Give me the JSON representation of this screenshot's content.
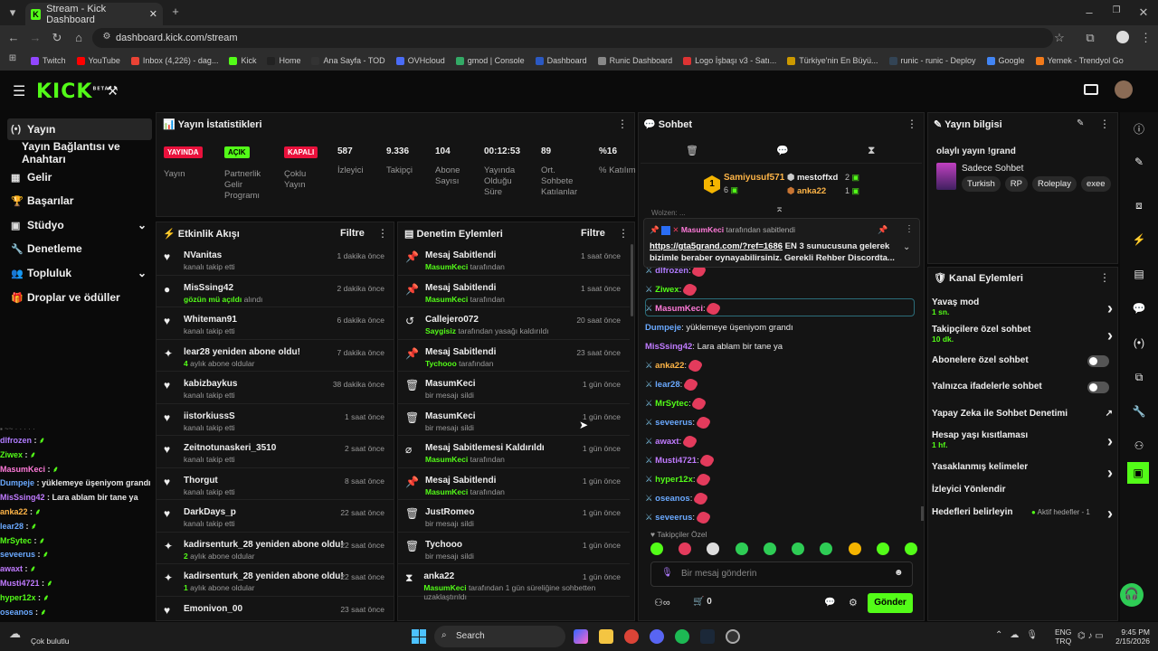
{
  "browser": {
    "tab_title": "Stream - Kick Dashboard",
    "url": "dashboard.kick.com/stream",
    "bookmarks": [
      "Twitch",
      "YouTube",
      "Inbox (4,226) - dag...",
      "Kick",
      "Home",
      "Ana Sayfa - TOD",
      "OVHcloud",
      "gmod | Console",
      "Dashboard",
      "Runic Dashboard",
      "Logo İşbaşı v3 - Satı...",
      "Türkiye'nin En Büyü...",
      "runic - runic - Deploy",
      "Google",
      "Yemek - Trendyol Go"
    ],
    "bookmark_colors": [
      "#9146ff",
      "#ff0000",
      "#ea4335",
      "#53fc18",
      "#222",
      "#333",
      "#4a6cf7",
      "#3a6",
      "#2b59c3",
      "#888",
      "#d33",
      "#c90",
      "#345",
      "#4285f4",
      "#f27a1a"
    ]
  },
  "kick": {
    "logo": "KICK",
    "beta": "BETA"
  },
  "sidebar": {
    "items": [
      {
        "label": "Yayın",
        "icon": "(•)"
      },
      {
        "label": "Yayın Bağlantısı ve Anahtarı",
        "icon": ""
      },
      {
        "label": "Gelir",
        "icon": "▦"
      },
      {
        "label": "Başarılar",
        "icon": "🏆"
      },
      {
        "label": "Stüdyo",
        "icon": "▣",
        "chevron": "⌄"
      },
      {
        "label": "Denetleme",
        "icon": "🔧"
      },
      {
        "label": "Topluluk",
        "icon": "👥",
        "chevron": "⌄"
      },
      {
        "label": "Droplar ve ödüller",
        "icon": "🎁"
      }
    ]
  },
  "stats": {
    "title": "Yayın İstatistikleri",
    "tags": [
      {
        "tag": "YAYINDA",
        "label": "Yayın",
        "color": "#e9113c"
      },
      {
        "tag": "AÇIK",
        "label": "Partnerlik Gelir Programı",
        "color": "#53fc18"
      },
      {
        "tag": "KAPALI",
        "label": "Çoklu Yayın",
        "color": "#e9113c"
      }
    ],
    "numbers": [
      {
        "value": "587",
        "label": "İzleyici"
      },
      {
        "value": "9.336",
        "label": "Takipçi"
      },
      {
        "value": "104",
        "label": "Abone Sayısı"
      },
      {
        "value": "00:12:53",
        "label": "Yayında Olduğu Süre"
      },
      {
        "value": "89",
        "label": "Ort. Sohbete Katılanlar"
      },
      {
        "value": "%16",
        "label": "% Katılım"
      }
    ]
  },
  "activity": {
    "title": "Etkinlik Akışı",
    "filter": "Filtre",
    "rows": [
      {
        "icon": "♥",
        "name": "NVanitas",
        "sub": "kanalı takip etti",
        "subhl": "",
        "time": "1 dakika önce"
      },
      {
        "icon": "●",
        "name": "MisSsing42",
        "sub": "alındı",
        "subhl": "gözün mü açıldı",
        "time": "2 dakika önce"
      },
      {
        "icon": "♥",
        "name": "Whiteman91",
        "sub": "kanalı takip etti",
        "subhl": "",
        "time": "6 dakika önce"
      },
      {
        "icon": "✦",
        "name": "lear28 yeniden abone oldu!",
        "sub": "aylık abone oldular",
        "subhl": "4",
        "time": "7 dakika önce"
      },
      {
        "icon": "♥",
        "name": "kabizbaykus",
        "sub": "kanalı takip etti",
        "subhl": "",
        "time": "38 dakika önce"
      },
      {
        "icon": "♥",
        "name": "iistorkiussS",
        "sub": "kanalı takip etti",
        "subhl": "",
        "time": "1 saat önce"
      },
      {
        "icon": "♥",
        "name": "Zeitnotunaskeri_3510",
        "sub": "kanalı takip etti",
        "subhl": "",
        "time": "2 saat önce"
      },
      {
        "icon": "♥",
        "name": "Thorgut",
        "sub": "kanalı takip etti",
        "subhl": "",
        "time": "8 saat önce"
      },
      {
        "icon": "♥",
        "name": "DarkDays_p",
        "sub": "kanalı takip etti",
        "subhl": "",
        "time": "22 saat önce"
      },
      {
        "icon": "✦",
        "name": "kadirsenturk_28 yeniden abone oldu!",
        "sub": "aylık abone oldular",
        "subhl": "2",
        "time": "22 saat önce"
      },
      {
        "icon": "✦",
        "name": "kadirsenturk_28 yeniden abone oldu!",
        "sub": "aylık abone oldular",
        "subhl": "1",
        "time": "22 saat önce"
      },
      {
        "icon": "♥",
        "name": "Emonivon_00",
        "sub": "",
        "subhl": "",
        "time": "23 saat önce"
      }
    ]
  },
  "moderation": {
    "title": "Denetim Eylemleri",
    "filter": "Filtre",
    "rows": [
      {
        "icon": "📌",
        "name": "Mesaj Sabitlendi",
        "subhl": "MasumKeci",
        "sub": "tarafından",
        "time": "1 saat önce"
      },
      {
        "icon": "📌",
        "name": "Mesaj Sabitlendi",
        "subhl": "MasumKeci",
        "sub": "tarafından",
        "time": "1 saat önce"
      },
      {
        "icon": "↺",
        "name": "Callejero072",
        "subhl": "Saygisiz",
        "sub": "tarafından yasağı kaldırıldı",
        "time": "20 saat önce"
      },
      {
        "icon": "📌",
        "name": "Mesaj Sabitlendi",
        "subhl": "Tychooo",
        "sub": "tarafından",
        "time": "23 saat önce"
      },
      {
        "icon": "🗑",
        "name": "MasumKeci",
        "subhl": "",
        "sub": "bir mesajı sildi",
        "time": "1 gün önce"
      },
      {
        "icon": "🗑",
        "name": "MasumKeci",
        "subhl": "",
        "sub": "bir mesajı sildi",
        "time": "1 gün önce"
      },
      {
        "icon": "⌀",
        "name": "Mesaj Sabitlemesi Kaldırıldı",
        "subhl": "MasumKeci",
        "sub": "tarafından",
        "time": "1 gün önce"
      },
      {
        "icon": "📌",
        "name": "Mesaj Sabitlendi",
        "subhl": "MasumKeci",
        "sub": "tarafından",
        "time": "1 gün önce"
      },
      {
        "icon": "🗑",
        "name": "JustRomeo",
        "subhl": "",
        "sub": "bir mesajı sildi",
        "time": "1 gün önce"
      },
      {
        "icon": "🗑",
        "name": "Tychooo",
        "subhl": "",
        "sub": "bir mesajı sildi",
        "time": "1 gün önce"
      },
      {
        "icon": "⧗",
        "name": "anka22",
        "subhl": "MasumKeci",
        "sub": "tarafından 1 gün süreliğine sohbetten uzaklaştırıldı",
        "time": "1 gün önce"
      }
    ]
  },
  "chat": {
    "title": "Sohbet",
    "leaders": [
      {
        "name": "Samiyusuf571",
        "val": "6"
      },
      {
        "name": "mestoffxd",
        "val": "2"
      },
      {
        "name": "anka22",
        "val": "1"
      }
    ],
    "pinned": {
      "author": "MasumKeci",
      "by": "tarafından sabitlendi",
      "link": "https://gta5grand.com/?ref=1686",
      "text": "EN 3 sunucusuna gelerek bizimle beraber oynayabilirsiniz. Gerekli Rehber Discordta..."
    },
    "partial": "Wolzen: ...",
    "messages": [
      {
        "user": "dlfrozen",
        "color": "#b07cff",
        "text": ""
      },
      {
        "user": "Ziwex",
        "color": "#53fc18",
        "text": ""
      },
      {
        "user": "MasumKeci",
        "color": "#ff7ad9",
        "text": ""
      },
      {
        "user": "Dumpeje",
        "color": "#6aa9ff",
        "text": "yüklemeye üşeniyom grandı"
      },
      {
        "user": "MisSsing42",
        "color": "#c07bff",
        "text": "Lara ablam bir tane ya"
      },
      {
        "user": "anka22",
        "color": "#ffb547",
        "text": ""
      },
      {
        "user": "lear28",
        "color": "#6aa9ff",
        "text": ""
      },
      {
        "user": "MrSytec",
        "color": "#53fc18",
        "text": ""
      },
      {
        "user": "seveerus",
        "color": "#6aa9ff",
        "text": ""
      },
      {
        "user": "awaxt",
        "color": "#c07bff",
        "text": ""
      },
      {
        "user": "Musti4721",
        "color": "#c07bff",
        "text": ""
      },
      {
        "user": "hyper12x",
        "color": "#53fc18",
        "text": ""
      },
      {
        "user": "oseanos",
        "color": "#6aa9ff",
        "text": ""
      },
      {
        "user": "seveerus",
        "color": "#6aa9ff",
        "text": ""
      }
    ],
    "emote_section": "Takipçiler Özel",
    "input_placeholder": "Bir mesaj gönderin",
    "points": "0",
    "send": "Gönder"
  },
  "info": {
    "title": "Yayın bilgisi",
    "stream_title": "olaylı yayın !grand",
    "category": "Sadece Sohbet",
    "tags": [
      "Turkish",
      "RP",
      "Roleplay",
      "exee"
    ]
  },
  "channel": {
    "title": "Kanal Eylemleri",
    "items": [
      {
        "label": "Yavaş mod",
        "sub": "1 sn.",
        "ctrl": "chev"
      },
      {
        "label": "Takipçilere özel sohbet",
        "sub": "10 dk.",
        "ctrl": "chev"
      },
      {
        "label": "Abonelere özel sohbet",
        "sub": "",
        "ctrl": "toggle"
      },
      {
        "label": "Yalnızca ifadelerle sohbet",
        "sub": "",
        "ctrl": "toggle"
      },
      {
        "label": "Yapay Zeka ile Sohbet Denetimi",
        "sub": "",
        "ctrl": "ext"
      },
      {
        "label": "Hesap yaşı kısıtlaması",
        "sub": "1 hf.",
        "ctrl": "chev"
      },
      {
        "label": "Yasaklanmış kelimeler",
        "sub": "",
        "ctrl": "chev"
      },
      {
        "label": "İzleyici Yönlendir",
        "sub": "",
        "ctrl": ""
      },
      {
        "label": "Hedefleri belirleyin",
        "sub": "",
        "ctrl": "goal"
      }
    ],
    "goal_text": "Aktif hedefler - 1"
  },
  "overlay_chat": [
    {
      "user": "dlfrozen",
      "color": "#b07cff"
    },
    {
      "user": "Ziwex",
      "color": "#53fc18"
    },
    {
      "user": "MasumKeci",
      "color": "#ff7ad9"
    },
    {
      "user": "Dumpeje",
      "color": "#6aa9ff",
      "text": "yüklemeye üşeniyom grandı"
    },
    {
      "user": "MisSsing42",
      "color": "#c07bff",
      "text": "Lara ablam bir tane ya"
    },
    {
      "user": "anka22",
      "color": "#ffb547"
    },
    {
      "user": "lear28",
      "color": "#6aa9ff"
    },
    {
      "user": "MrSytec",
      "color": "#53fc18"
    },
    {
      "user": "seveerus",
      "color": "#6aa9ff"
    },
    {
      "user": "awaxt",
      "color": "#c07bff"
    },
    {
      "user": "Musti4721",
      "color": "#c07bff"
    },
    {
      "user": "hyper12x",
      "color": "#53fc18"
    },
    {
      "user": "oseanos",
      "color": "#6aa9ff"
    },
    {
      "user": "seveerus",
      "color": "#6aa9ff"
    }
  ],
  "taskbar": {
    "weather": "Çok bulutlu",
    "search": "Search",
    "lang1": "ENG",
    "lang2": "TRQ",
    "time": "9:45 PM",
    "date": "2/15/2026"
  }
}
